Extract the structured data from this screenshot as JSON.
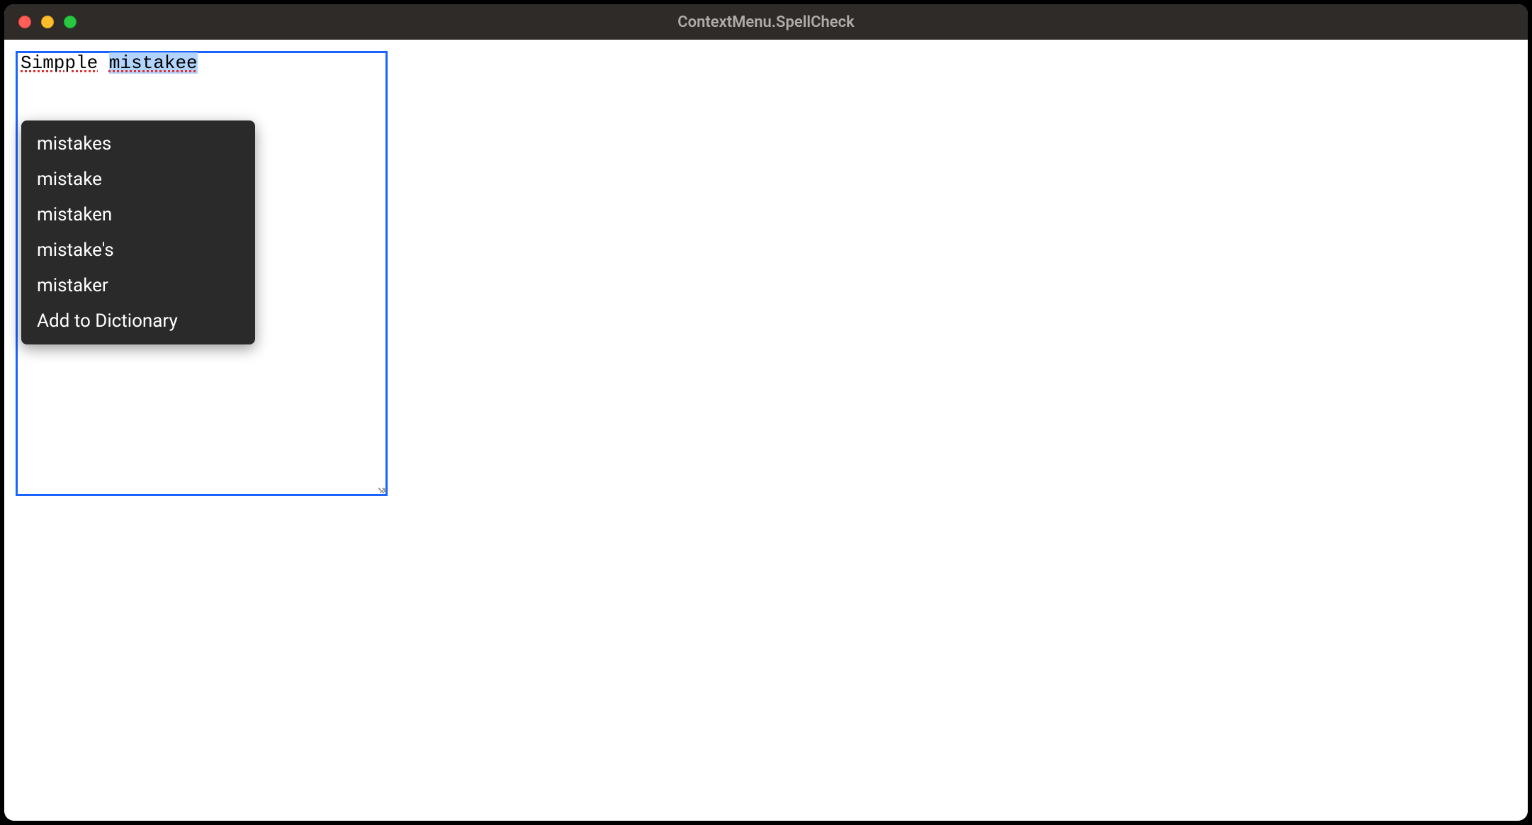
{
  "window": {
    "title": "ContextMenu.SpellCheck"
  },
  "editor": {
    "word1": "Simpple",
    "word2": "mistakee"
  },
  "context_menu": {
    "items": [
      "mistakes",
      "mistake",
      "mistaken",
      "mistake's",
      "mistaker",
      "Add to Dictionary"
    ]
  }
}
